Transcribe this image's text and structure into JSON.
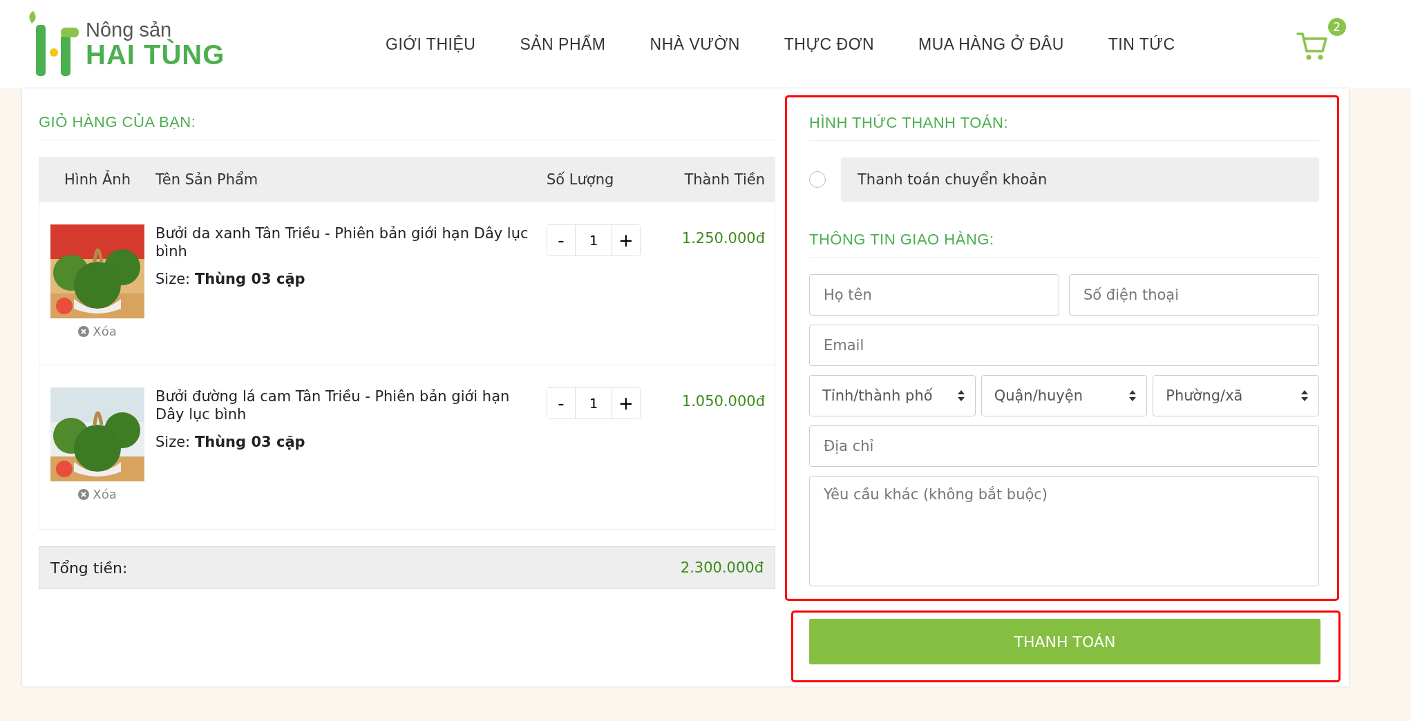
{
  "header": {
    "logo": {
      "line_1": "Nông sản",
      "line_2": "HAI TÙNG"
    },
    "nav": [
      {
        "label": "GIỚI THIỆU",
        "selected": false
      },
      {
        "label": "SẢN PHẨM",
        "selected": false
      },
      {
        "label": "NHÀ VƯỜN",
        "selected": false
      },
      {
        "label": "THỰC ĐƠN",
        "selected": false
      },
      {
        "label": "MUA HÀNG Ở ĐÂU",
        "selected": false
      },
      {
        "label": "TIN TỨC",
        "selected": false
      }
    ],
    "cart_count": "2"
  },
  "cart": {
    "title": "GIỎ HÀNG CỦA BẠN:",
    "columns": [
      "Hình Ảnh",
      "Tên Sản Phẩm",
      "Số Lượng",
      "Thành Tiền"
    ],
    "rows": [
      {
        "remove": "Xóa",
        "name": "Bưởi da xanh Tân Triều - Phiên bản giới hạn Dây lục bình",
        "size_label": "Size:",
        "size": "Thùng 03 cặp",
        "minus": "-",
        "quantity": "1",
        "plus": "+",
        "price": "1.250.000đ"
      },
      {
        "remove": "Xóa",
        "name": "Bưởi đường lá cam Tân Triều - Phiên bản giới hạn Dây lục bình",
        "size_label": "Size:",
        "size": "Thùng 03 cặp",
        "minus": "-",
        "quantity": "1",
        "plus": "+",
        "price": "1.050.000đ"
      }
    ],
    "total_label": "Tổng tiền:",
    "total": "2.300.000đ"
  },
  "payment": {
    "title": "HÌNH THỨC THANH TOÁN:",
    "options": [
      {
        "label": "Thanh toán chuyển khoản",
        "selected": false
      }
    ]
  },
  "shipping": {
    "title": "THÔNG TIN GIAO HÀNG:",
    "name": {
      "placeholder": "Họ tên"
    },
    "phone": {
      "placeholder": "Số điện thoại"
    },
    "email": {
      "placeholder": "Email"
    },
    "selects": [
      "Tỉnh/thành phố",
      "Quận/huyện",
      "Phường/xã"
    ],
    "address": {
      "placeholder": "Địa chỉ"
    },
    "note": {
      "placeholder": "Yêu cầu khác (không bắt buộc)"
    }
  },
  "submit": "THANH TOÁN"
}
